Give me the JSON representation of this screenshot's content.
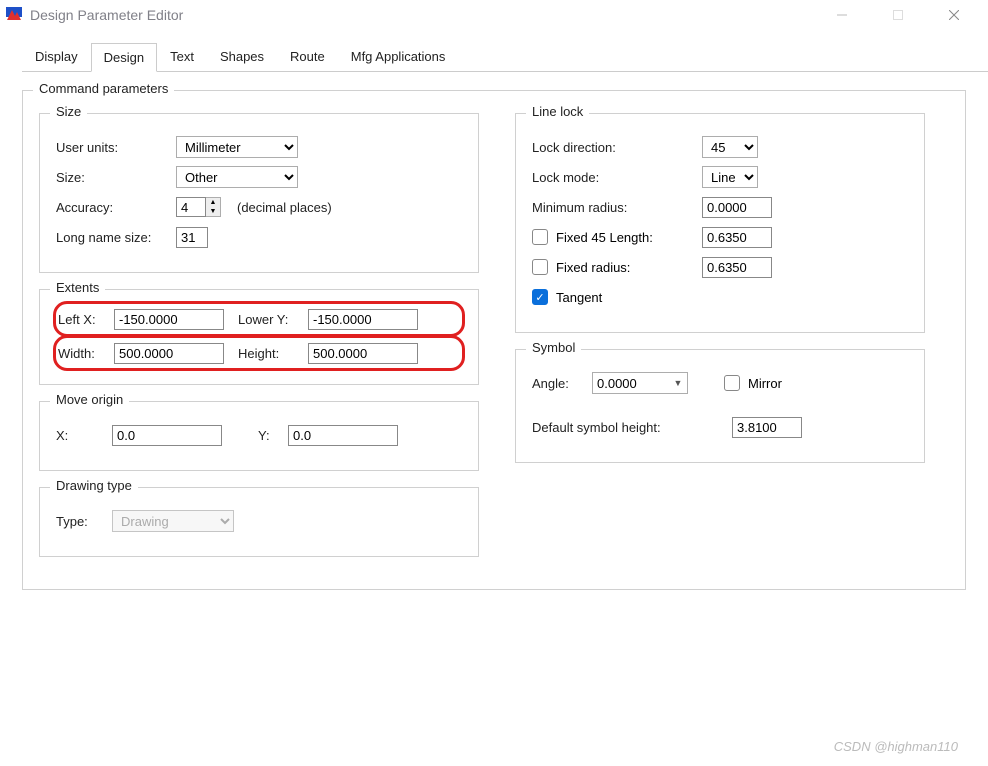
{
  "window": {
    "title": "Design Parameter Editor"
  },
  "tabs": [
    "Display",
    "Design",
    "Text",
    "Shapes",
    "Route",
    "Mfg Applications"
  ],
  "active_tab": "Design",
  "groups": {
    "command_parameters": "Command parameters",
    "size": "Size",
    "extents": "Extents",
    "move_origin": "Move origin",
    "drawing_type": "Drawing type",
    "line_lock": "Line lock",
    "symbol": "Symbol"
  },
  "size": {
    "user_units_label": "User units:",
    "user_units_value": "Millimeter",
    "size_label": "Size:",
    "size_value": "Other",
    "accuracy_label": "Accuracy:",
    "accuracy_value": "4",
    "accuracy_hint": "(decimal places)",
    "long_name_label": "Long name size:",
    "long_name_value": "31"
  },
  "extents": {
    "left_x_label": "Left X:",
    "left_x_value": "-150.0000",
    "lower_y_label": "Lower Y:",
    "lower_y_value": "-150.0000",
    "width_label": "Width:",
    "width_value": "500.0000",
    "height_label": "Height:",
    "height_value": "500.0000"
  },
  "move_origin": {
    "x_label": "X:",
    "x_value": "0.0",
    "y_label": "Y:",
    "y_value": "0.0"
  },
  "drawing_type": {
    "type_label": "Type:",
    "type_value": "Drawing"
  },
  "line_lock": {
    "direction_label": "Lock direction:",
    "direction_value": "45",
    "mode_label": "Lock mode:",
    "mode_value": "Line",
    "min_radius_label": "Minimum radius:",
    "min_radius_value": "0.0000",
    "fixed_45_label": "Fixed 45 Length:",
    "fixed_45_value": "0.6350",
    "fixed_45_checked": false,
    "fixed_radius_label": "Fixed radius:",
    "fixed_radius_value": "0.6350",
    "fixed_radius_checked": false,
    "tangent_label": "Tangent",
    "tangent_checked": true
  },
  "symbol": {
    "angle_label": "Angle:",
    "angle_value": "0.0000",
    "mirror_label": "Mirror",
    "mirror_checked": false,
    "default_height_label": "Default symbol height:",
    "default_height_value": "3.8100"
  },
  "watermark": "CSDN @highman110"
}
